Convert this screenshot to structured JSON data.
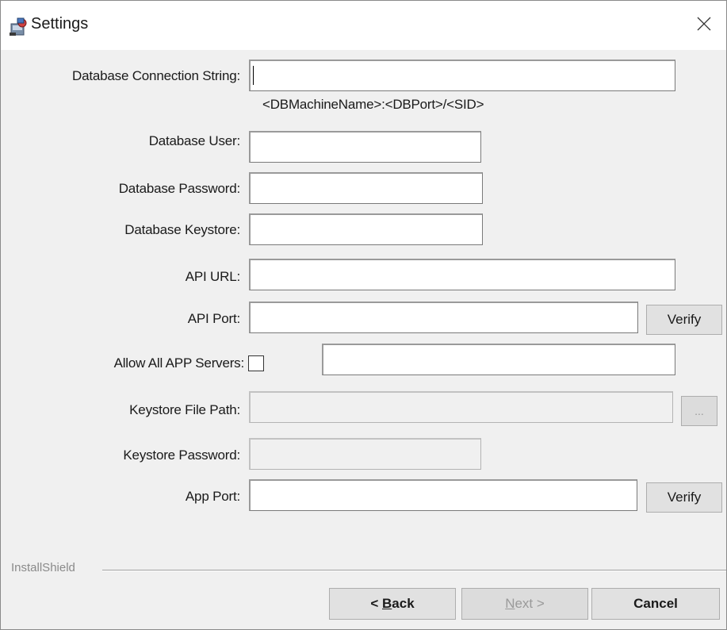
{
  "window": {
    "title": "Settings",
    "icon": "installer-icon",
    "close": "close-icon"
  },
  "fields": {
    "db_connection": {
      "label": "Database Connection String:",
      "value": "",
      "hint": "<DBMachineName>:<DBPort>/<SID>"
    },
    "db_user": {
      "label": "Database User:",
      "value": ""
    },
    "db_password": {
      "label": "Database Password:",
      "value": ""
    },
    "db_keystore": {
      "label": "Database Keystore:",
      "value": ""
    },
    "api_url": {
      "label": "API URL:",
      "value": ""
    },
    "api_port": {
      "label": "API Port:",
      "value": "",
      "button": "Verify"
    },
    "allow_all_app_servers": {
      "label": "Allow All APP Servers:",
      "checked": false,
      "value": ""
    },
    "keystore_file_path": {
      "label": "Keystore File Path:",
      "value": "",
      "button": "...",
      "disabled": true
    },
    "keystore_password": {
      "label": "Keystore Password:",
      "value": "",
      "disabled": true
    },
    "app_port": {
      "label": "App Port:",
      "value": "",
      "button": "Verify"
    }
  },
  "footer": {
    "brand": "InstallShield",
    "back": {
      "prefix": "< ",
      "mnemonic": "B",
      "rest": "ack"
    },
    "next": {
      "mnemonic": "N",
      "rest": "ext >",
      "disabled": true
    },
    "cancel": "Cancel"
  },
  "colors": {
    "dialog_bg": "#f0f0f0",
    "title_bg": "#ffffff",
    "button_bg": "#e1e1e1",
    "disabled_text": "#9a9a9a"
  }
}
